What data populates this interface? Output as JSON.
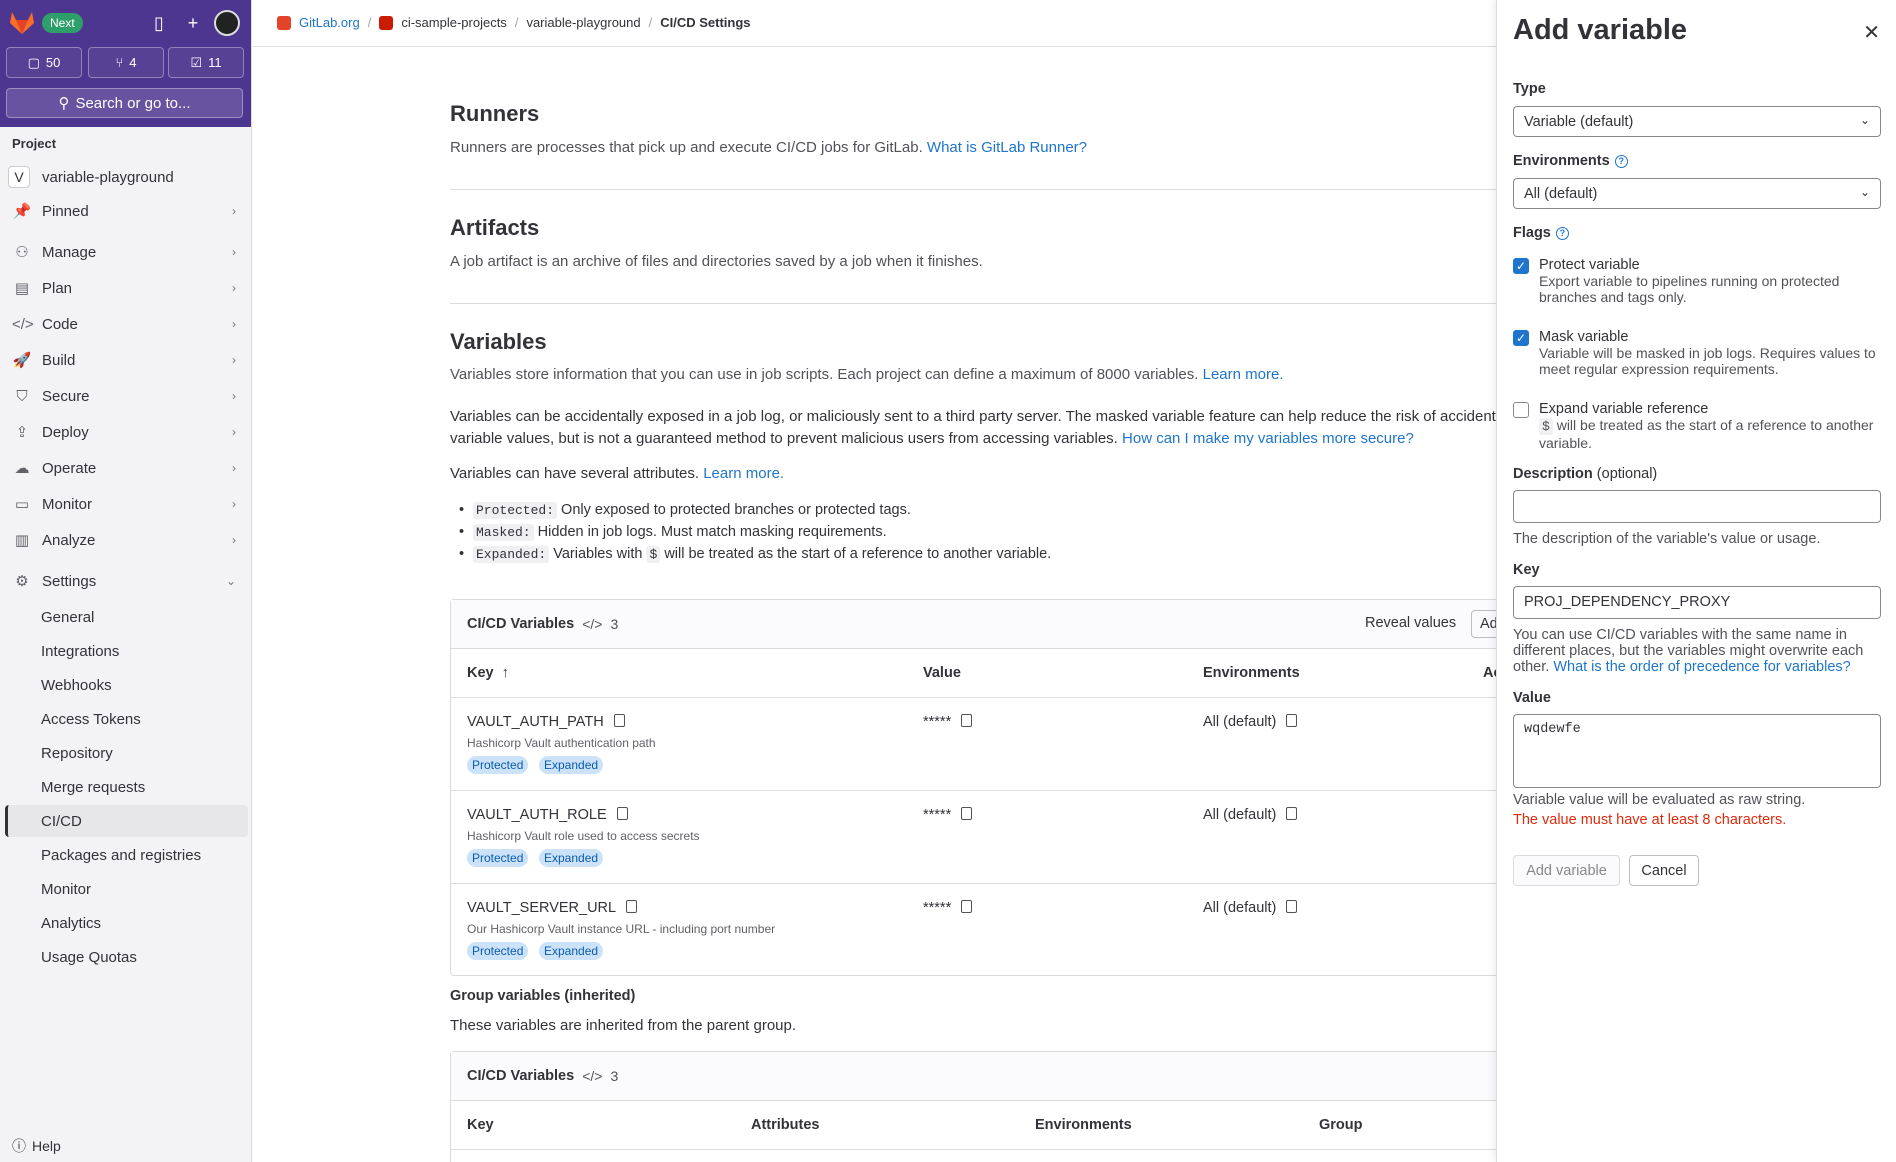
{
  "sidebar": {
    "next_badge": "Next",
    "counters": {
      "issues": "50",
      "merge_requests": "4",
      "todos": "11"
    },
    "search_label": "Search or go to...",
    "section_label": "Project",
    "project_initial": "V",
    "project_name": "variable-playground",
    "nav": [
      {
        "label": "Pinned",
        "icon": "pin-icon"
      },
      {
        "label": "Manage",
        "icon": "users-icon"
      },
      {
        "label": "Plan",
        "icon": "plan-icon"
      },
      {
        "label": "Code",
        "icon": "code-icon"
      },
      {
        "label": "Build",
        "icon": "rocket-icon"
      },
      {
        "label": "Secure",
        "icon": "shield-icon"
      },
      {
        "label": "Deploy",
        "icon": "deploy-icon"
      },
      {
        "label": "Operate",
        "icon": "cloud-icon"
      },
      {
        "label": "Monitor",
        "icon": "monitor-icon"
      },
      {
        "label": "Analyze",
        "icon": "chart-icon"
      },
      {
        "label": "Settings",
        "icon": "gear-icon"
      }
    ],
    "settings_items": [
      "General",
      "Integrations",
      "Webhooks",
      "Access Tokens",
      "Repository",
      "Merge requests",
      "CI/CD",
      "Packages and registries",
      "Monitor",
      "Analytics",
      "Usage Quotas"
    ],
    "help_label": "Help"
  },
  "breadcrumb": [
    "GitLab.org",
    "ci-sample-projects",
    "variable-playground",
    "CI/CD Settings"
  ],
  "main": {
    "runners": {
      "title": "Runners",
      "desc": "Runners are processes that pick up and execute CI/CD jobs for GitLab.",
      "link": "What is GitLab Runner?"
    },
    "artifacts": {
      "title": "Artifacts",
      "desc": "A job artifact is an archive of files and directories saved by a job when it finishes."
    },
    "variables": {
      "title": "Variables",
      "desc": "Variables store information that you can use in job scripts. Each project can define a maximum of 8000 variables.",
      "desc_link": "Learn more.",
      "warn_1": "Variables can be accidentally exposed in a job log, or maliciously sent to a third party server. The masked variable feature can help reduce the risk of accident",
      "warn_2": "variable values, but is not a guaranteed method to prevent malicious users from accessing variables.",
      "warn_link": "How can I make my variables more secure?",
      "attrs_intro": "Variables can have several attributes.",
      "attrs_link": "Learn more.",
      "bullets": [
        {
          "code": "Protected:",
          "text": "Only exposed to protected branches or protected tags."
        },
        {
          "code": "Masked:",
          "text": "Hidden in job logs. Must match masking requirements."
        },
        {
          "code": "Expanded:",
          "pre": "Variables with",
          "code2": "$",
          "text": "will be treated as the start of a reference to another variable."
        }
      ]
    },
    "table": {
      "title": "CI/CD Variables",
      "count": "3",
      "reveal": "Reveal values",
      "add_button": "Ad",
      "headers": [
        "Key",
        "Value",
        "Environments",
        "Ac"
      ],
      "rows": [
        {
          "key": "VAULT_AUTH_PATH",
          "desc": "Hashicorp Vault authentication path",
          "value": "*****",
          "env": "All (default)",
          "badges": [
            "Protected",
            "Expanded"
          ]
        },
        {
          "key": "VAULT_AUTH_ROLE",
          "desc": "Hashicorp Vault role used to access secrets",
          "value": "*****",
          "env": "All (default)",
          "badges": [
            "Protected",
            "Expanded"
          ]
        },
        {
          "key": "VAULT_SERVER_URL",
          "desc": "Our Hashicorp Vault instance URL - including port number",
          "value": "*****",
          "env": "All (default)",
          "badges": [
            "Protected",
            "Expanded"
          ]
        }
      ]
    },
    "group": {
      "title": "Group variables (inherited)",
      "desc": "These variables are inherited from the parent group.",
      "table_title": "CI/CD Variables",
      "count": "3",
      "headers": [
        "Key",
        "Attributes",
        "Environments",
        "Group"
      ]
    }
  },
  "drawer": {
    "title": "Add variable",
    "type_label": "Type",
    "type_value": "Variable (default)",
    "env_label": "Environments",
    "env_value": "All (default)",
    "flags_label": "Flags",
    "protect": {
      "label": "Protect variable",
      "desc": "Export variable to pipelines running on protected branches and tags only.",
      "checked": true
    },
    "mask": {
      "label": "Mask variable",
      "desc": "Variable will be masked in job logs. Requires values to meet regular expression requirements.",
      "checked": true
    },
    "expand": {
      "label": "Expand variable reference",
      "code": "$",
      "desc": "will be treated as the start of a reference to another variable.",
      "checked": false
    },
    "desc_label": "Description",
    "desc_optional": "(optional)",
    "desc_help": "The description of the variable's value or usage.",
    "key_label": "Key",
    "key_value": "PROJ_DEPENDENCY_PROXY",
    "key_help": "You can use CI/CD variables with the same name in different places, but the variables might overwrite each other.",
    "key_help_link": "What is the order of precedence for variables?",
    "value_label": "Value",
    "value_value": "wqdewfe",
    "value_help": "Variable value will be evaluated as raw string.",
    "value_error": "The value must have at least 8 characters.",
    "add_button": "Add variable",
    "cancel_button": "Cancel"
  }
}
